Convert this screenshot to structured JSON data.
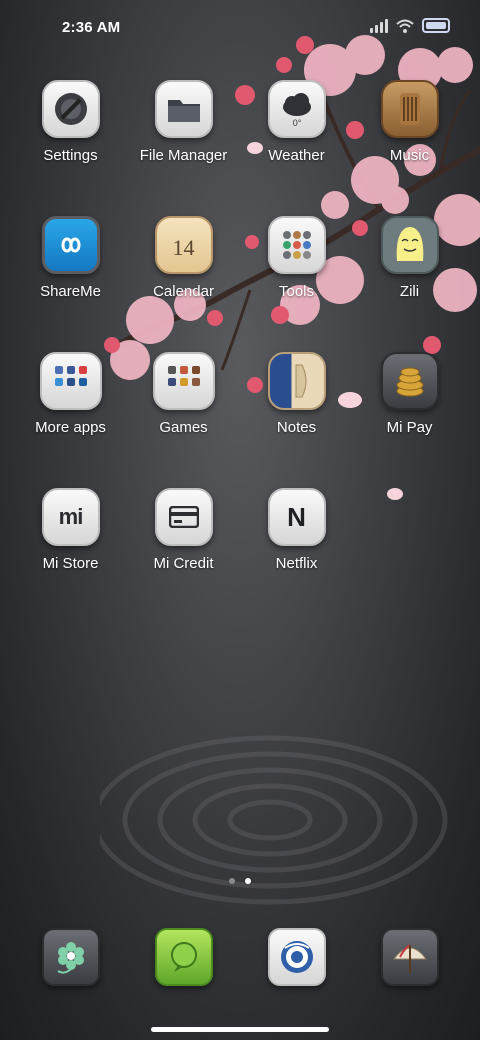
{
  "status": {
    "time": "2:36 AM"
  },
  "apps": [
    {
      "label": "Settings"
    },
    {
      "label": "File Manager"
    },
    {
      "label": "Weather",
      "temp": "0°"
    },
    {
      "label": "Music"
    },
    {
      "label": "ShareMe"
    },
    {
      "label": "Calendar",
      "day": "14"
    },
    {
      "label": "Tools"
    },
    {
      "label": "Zili"
    },
    {
      "label": "More apps"
    },
    {
      "label": "Games"
    },
    {
      "label": "Notes"
    },
    {
      "label": "Mi Pay"
    },
    {
      "label": "Mi Store",
      "glyph": "mi"
    },
    {
      "label": "Mi Credit"
    },
    {
      "label": "Netflix",
      "glyph": "N"
    }
  ],
  "pages": {
    "count": 2,
    "active": 2
  },
  "dock": [
    {
      "icon": "flower-icon"
    },
    {
      "icon": "message-bubble-icon"
    },
    {
      "icon": "browser-icon"
    },
    {
      "icon": "umbrella-icon"
    }
  ]
}
